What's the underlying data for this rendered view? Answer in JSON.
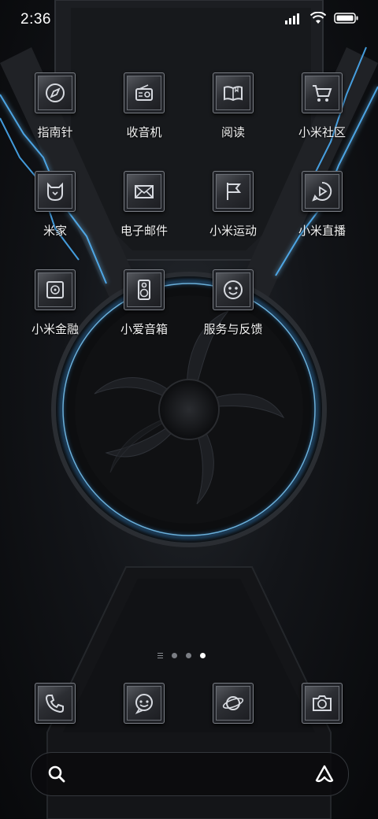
{
  "status_bar": {
    "time": "2:36",
    "icons": [
      "signal-icon",
      "wifi-icon",
      "battery-icon"
    ]
  },
  "apps": [
    {
      "label": "指南针",
      "icon": "compass-icon"
    },
    {
      "label": "收音机",
      "icon": "radio-icon"
    },
    {
      "label": "阅读",
      "icon": "book-icon"
    },
    {
      "label": "小米社区",
      "icon": "shopping-cart-icon"
    },
    {
      "label": "米家",
      "icon": "mijia-icon"
    },
    {
      "label": "电子邮件",
      "icon": "mail-icon"
    },
    {
      "label": "小米运动",
      "icon": "flag-icon"
    },
    {
      "label": "小米直播",
      "icon": "play-bubble-icon"
    },
    {
      "label": "小米金融",
      "icon": "safe-icon"
    },
    {
      "label": "小爱音箱",
      "icon": "speaker-icon"
    },
    {
      "label": "服务与反馈",
      "icon": "feedback-icon"
    }
  ],
  "page_indicator": {
    "pages": 3,
    "active_page": 3
  },
  "dock": [
    {
      "icon": "phone-icon"
    },
    {
      "icon": "message-icon"
    },
    {
      "icon": "browser-planet-icon"
    },
    {
      "icon": "camera-icon"
    }
  ],
  "search": {
    "placeholder": "",
    "assistant_icon": "xiaoai-icon"
  },
  "colors": {
    "accent_glow": "#3fa9ff",
    "tile_border": "#7b7f86"
  }
}
